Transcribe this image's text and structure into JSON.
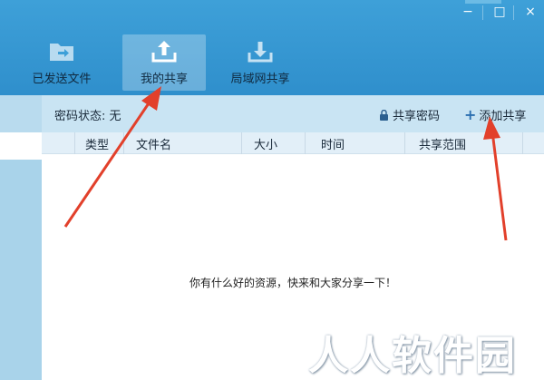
{
  "window_controls": {
    "minimize": "−",
    "maximize": "□",
    "close": "×"
  },
  "toolbar": {
    "items": [
      {
        "label": "已发送文件",
        "icon": "folder-send-icon",
        "active": false
      },
      {
        "label": "我的共享",
        "icon": "upload-icon",
        "active": true
      },
      {
        "label": "局域网共享",
        "icon": "download-icon",
        "active": false
      }
    ]
  },
  "infobar": {
    "password_status": "密码状态: 无",
    "share_password": "共享密码",
    "add_share": "添加共享",
    "add_symbol": "+"
  },
  "table": {
    "columns": [
      "类型",
      "文件名",
      "大小",
      "时间",
      "共享范围"
    ],
    "rows": []
  },
  "empty_message": "你有什么好的资源，快来和大家分享一下！",
  "watermark": "人人软件园",
  "colors": {
    "toolbar": "#3ea0d8",
    "infobar": "#c9e4f3",
    "header": "#e2eff8",
    "arrow": "#e2402b"
  }
}
